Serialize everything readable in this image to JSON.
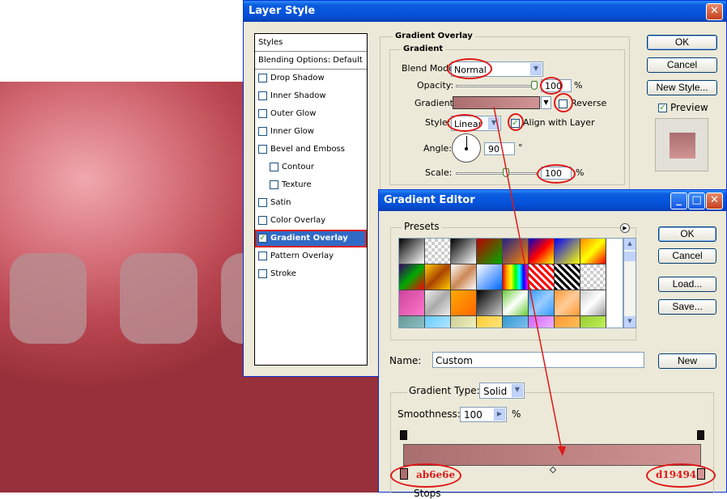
{
  "layer_style": {
    "title": "Layer Style",
    "close_glyph": "✕",
    "styles_header": "Styles",
    "blending_options": "Blending Options: Default",
    "style_items": [
      {
        "label": "Drop Shadow",
        "checked": false,
        "indent": false,
        "selected": false
      },
      {
        "label": "Inner Shadow",
        "checked": false,
        "indent": false,
        "selected": false
      },
      {
        "label": "Outer Glow",
        "checked": false,
        "indent": false,
        "selected": false
      },
      {
        "label": "Inner Glow",
        "checked": false,
        "indent": false,
        "selected": false
      },
      {
        "label": "Bevel and Emboss",
        "checked": false,
        "indent": false,
        "selected": false
      },
      {
        "label": "Contour",
        "checked": false,
        "indent": true,
        "selected": false
      },
      {
        "label": "Texture",
        "checked": false,
        "indent": true,
        "selected": false
      },
      {
        "label": "Satin",
        "checked": false,
        "indent": false,
        "selected": false
      },
      {
        "label": "Color Overlay",
        "checked": false,
        "indent": false,
        "selected": false
      },
      {
        "label": "Gradient Overlay",
        "checked": true,
        "indent": false,
        "selected": true
      },
      {
        "label": "Pattern Overlay",
        "checked": false,
        "indent": false,
        "selected": false
      },
      {
        "label": "Stroke",
        "checked": false,
        "indent": false,
        "selected": false
      }
    ],
    "section_title": "Gradient Overlay",
    "group_title": "Gradient",
    "blend_mode_label": "Blend Mode:",
    "blend_mode_value": "Normal",
    "opacity_label": "Opacity:",
    "opacity_value": "100",
    "percent": "%",
    "gradient_label": "Gradient:",
    "reverse_label": "Reverse",
    "style_label": "Style:",
    "style_value": "Linear",
    "align_label": "Align with Layer",
    "angle_label": "Angle:",
    "angle_value": "90",
    "degree": "°",
    "scale_label": "Scale:",
    "scale_value": "100",
    "buttons": {
      "ok": "OK",
      "cancel": "Cancel",
      "new_style": "New Style..."
    },
    "preview_label": "Preview"
  },
  "gradient_editor": {
    "title": "Gradient Editor",
    "buttons": {
      "minimize": "_",
      "maximize": "□",
      "close": "✕",
      "ok": "OK",
      "cancel": "Cancel",
      "load": "Load...",
      "save": "Save...",
      "new": "New"
    },
    "presets_label": "Presets",
    "name_label": "Name:",
    "name_value": "Custom",
    "gradient_type_label": "Gradient Type:",
    "gradient_type_value": "Solid",
    "smoothness_label": "Smoothness:",
    "smoothness_value": "100",
    "percent": "%",
    "stops_label": "Stops",
    "start_color_label": "ab6e6e",
    "end_color_label": "d19494"
  },
  "colors": {
    "gradient_start": "#ab6e6e",
    "gradient_end": "#d19494",
    "selection": "#316ac5",
    "annotation": "#e01818",
    "titlebar": "#0451d8"
  }
}
